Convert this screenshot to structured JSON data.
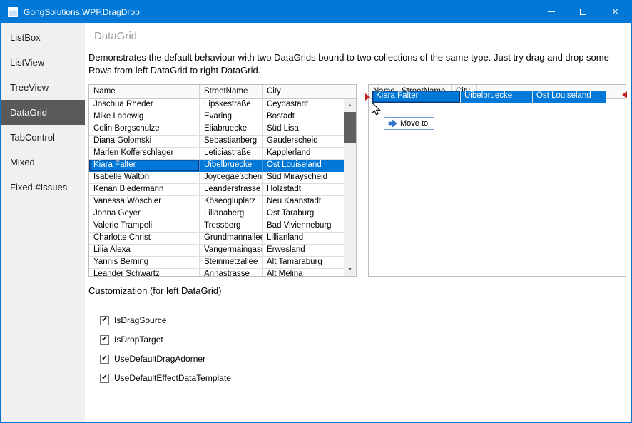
{
  "window": {
    "title": "GongSolutions.WPF.DragDrop"
  },
  "icons": {
    "close": "×",
    "scroll_up": "▲",
    "scroll_down": "▼",
    "check": "✔"
  },
  "colors": {
    "accent": "#0078d7",
    "selection": "#0078d7",
    "sidebar_selected": "#595959",
    "insertion_caret": "#c02222"
  },
  "sidebar": {
    "items": [
      "ListBox",
      "ListView",
      "TreeView",
      "DataGrid",
      "TabControl",
      "Mixed",
      "Fixed #Issues"
    ],
    "selected_index": 3
  },
  "header": {
    "title": "DataGrid"
  },
  "description": "Demonstrates the default behaviour with two DataGrids bound to two collections of the same type. Just try drag and drop some Rows from left DataGrid to right DataGrid.",
  "left_grid": {
    "columns": [
      "Name",
      "StreetName",
      "City"
    ],
    "selected_index": 5,
    "rows": [
      [
        "Joschua Rheder",
        "Lipskestraße",
        "Ceydastadt"
      ],
      [
        "Mike Ladewig",
        "Evaring",
        "Bostadt"
      ],
      [
        "Colin Borgschulze",
        "Eliabruecke",
        "Süd Lisa"
      ],
      [
        "Diana Golomski",
        "Sebastianberg",
        "Gauderscheid"
      ],
      [
        "Marlen Kofferschlager",
        "Leticiastraße",
        "Kapplerland"
      ],
      [
        "Kiara Falter",
        "Uibelbruecke",
        "Ost Louiseland"
      ],
      [
        "Isabelle Walton",
        "Joycegaeßchen",
        "Süd Mirayscheid"
      ],
      [
        "Kenan Biedermann",
        "Leanderstrasse",
        "Holzstadt"
      ],
      [
        "Vanessa Wöschler",
        "Köseogluplatz",
        "Neu Kaanstadt"
      ],
      [
        "Jonna Geyer",
        "Lilianaberg",
        "Ost Taraburg"
      ],
      [
        "Valerie Trampeli",
        "Tressberg",
        "Bad Vivienneburg"
      ],
      [
        "Charlotte Christ",
        "Grundmannallee",
        "Lillianland"
      ],
      [
        "Lilia Alexa",
        "Vangermaingasse",
        "Erwesland"
      ],
      [
        "Yannis Berning",
        "Steinmetzallee",
        "Alt Tamaraburg"
      ],
      [
        "Leander Schwartz",
        "Annastrasse",
        "Alt Melina"
      ]
    ]
  },
  "right_grid": {
    "columns": [
      "Name",
      "StreetName",
      "City"
    ]
  },
  "drag_adorner": {
    "name": "Kiara Falter",
    "street": "Uibelbruecke",
    "city": "Ost Louiseland",
    "effect_label": "Move to"
  },
  "customization": {
    "title": "Customization (for left DataGrid)",
    "checkboxes": [
      {
        "label": "IsDragSource",
        "checked": true
      },
      {
        "label": "IsDropTarget",
        "checked": true
      },
      {
        "label": "UseDefaultDragAdorner",
        "checked": true
      },
      {
        "label": "UseDefaultEffectDataTemplate",
        "checked": true
      }
    ]
  }
}
